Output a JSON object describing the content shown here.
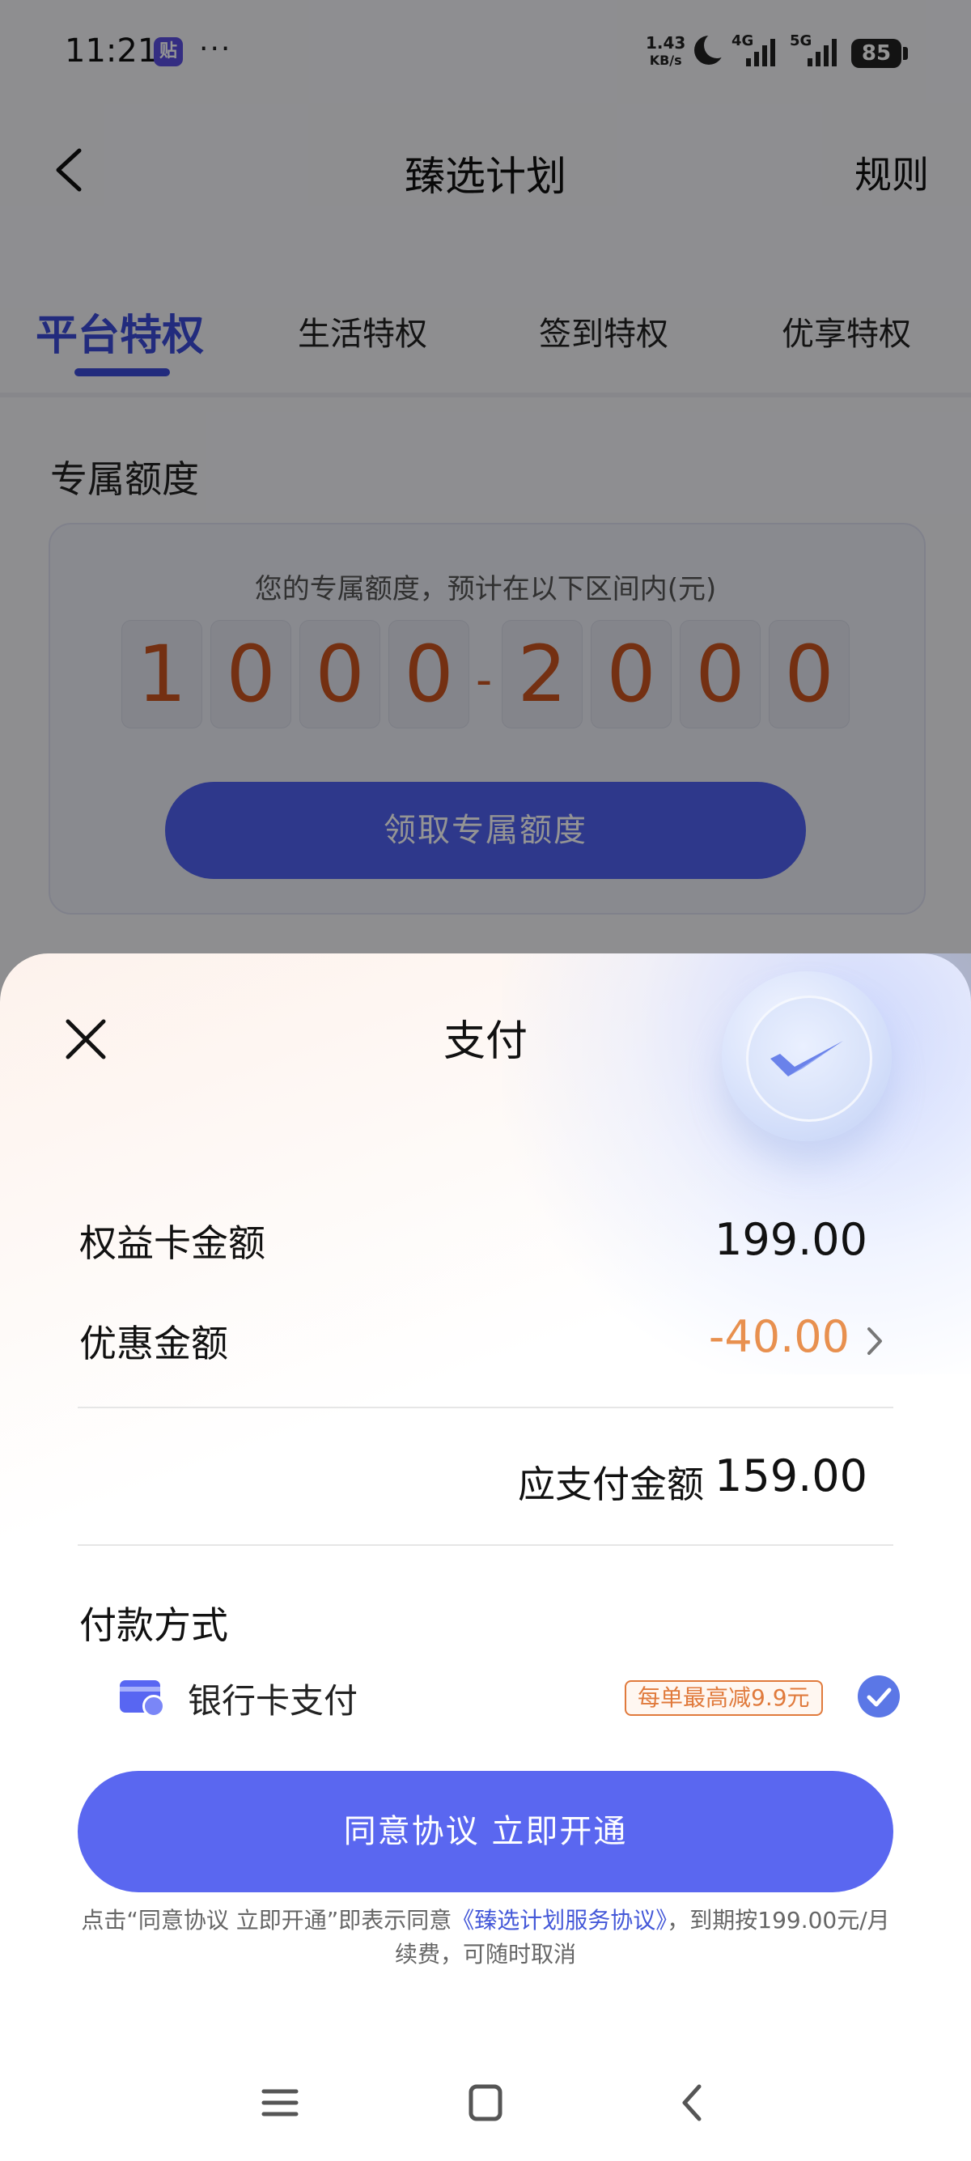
{
  "status_bar": {
    "time": "11:21",
    "app_badge": "贴",
    "more": "···",
    "net_speed_value": "1.43",
    "net_speed_unit": "KB/s",
    "signal_1_label": "4G",
    "signal_2_label": "5G",
    "battery": "85"
  },
  "header": {
    "title": "臻选计划",
    "rules": "规则"
  },
  "tabs": [
    {
      "label": "平台特权",
      "active": true
    },
    {
      "label": "生活特权",
      "active": false
    },
    {
      "label": "签到特权",
      "active": false
    },
    {
      "label": "优享特权",
      "active": false
    }
  ],
  "credit": {
    "section_title": "专属额度",
    "hint": "您的专属额度，预计在以下区间内(元)",
    "low_digits": [
      "1",
      "0",
      "0",
      "0"
    ],
    "separator": "-",
    "high_digits": [
      "2",
      "0",
      "0",
      "0"
    ],
    "claim_button": "领取专属额度"
  },
  "payment_sheet": {
    "title": "支付",
    "rows": {
      "card_amount_label": "权益卡金额",
      "card_amount_value": "199.00",
      "discount_label": "优惠金额",
      "discount_value": "-40.00",
      "payable_label": "应支付金额",
      "payable_value": "159.00"
    },
    "method_title": "付款方式",
    "method": {
      "name": "银行卡支付",
      "promo": "每单最高减9.9元",
      "selected": true
    },
    "agree_button": "同意协议 立即开通",
    "agreement_prefix": "点击“同意协议 立即开通”即表示同意",
    "agreement_link": "《臻选计划服务协议》",
    "agreement_suffix": "，到期按199.00元/月续费，可随时取消"
  },
  "colors": {
    "accent": "#3b4bd8",
    "button": "#5a67f0",
    "discount": "#e8904f",
    "digit": "#c8541f"
  }
}
